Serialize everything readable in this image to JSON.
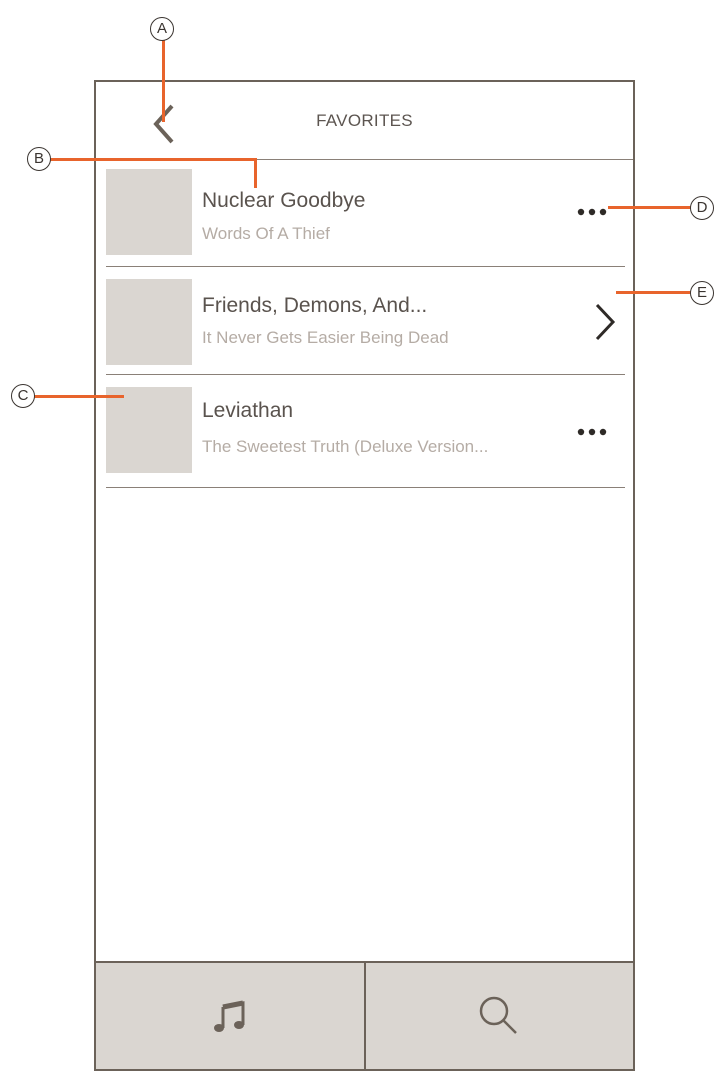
{
  "header": {
    "title": "FAVORITES"
  },
  "favorites": [
    {
      "song": "Nuclear Goodbye",
      "album": "Words Of A Thief",
      "action": "more-options"
    },
    {
      "song": "Friends, Demons, And...",
      "album": "It Never Gets Easier Being Dead",
      "action": "open"
    },
    {
      "song": "Leviathan",
      "album": "The Sweetest Truth (Deluxe Version...",
      "action": "more-options"
    }
  ],
  "tabbar": {
    "tabs": [
      {
        "icon": "music-note-icon"
      },
      {
        "icon": "search-icon"
      }
    ]
  },
  "annotations": {
    "a": "A",
    "b": "B",
    "c": "C",
    "d": "D",
    "e": "E"
  },
  "colors": {
    "frame": "#6b6259",
    "placeholder": "#dad6d1",
    "callout": "#e8642c"
  }
}
